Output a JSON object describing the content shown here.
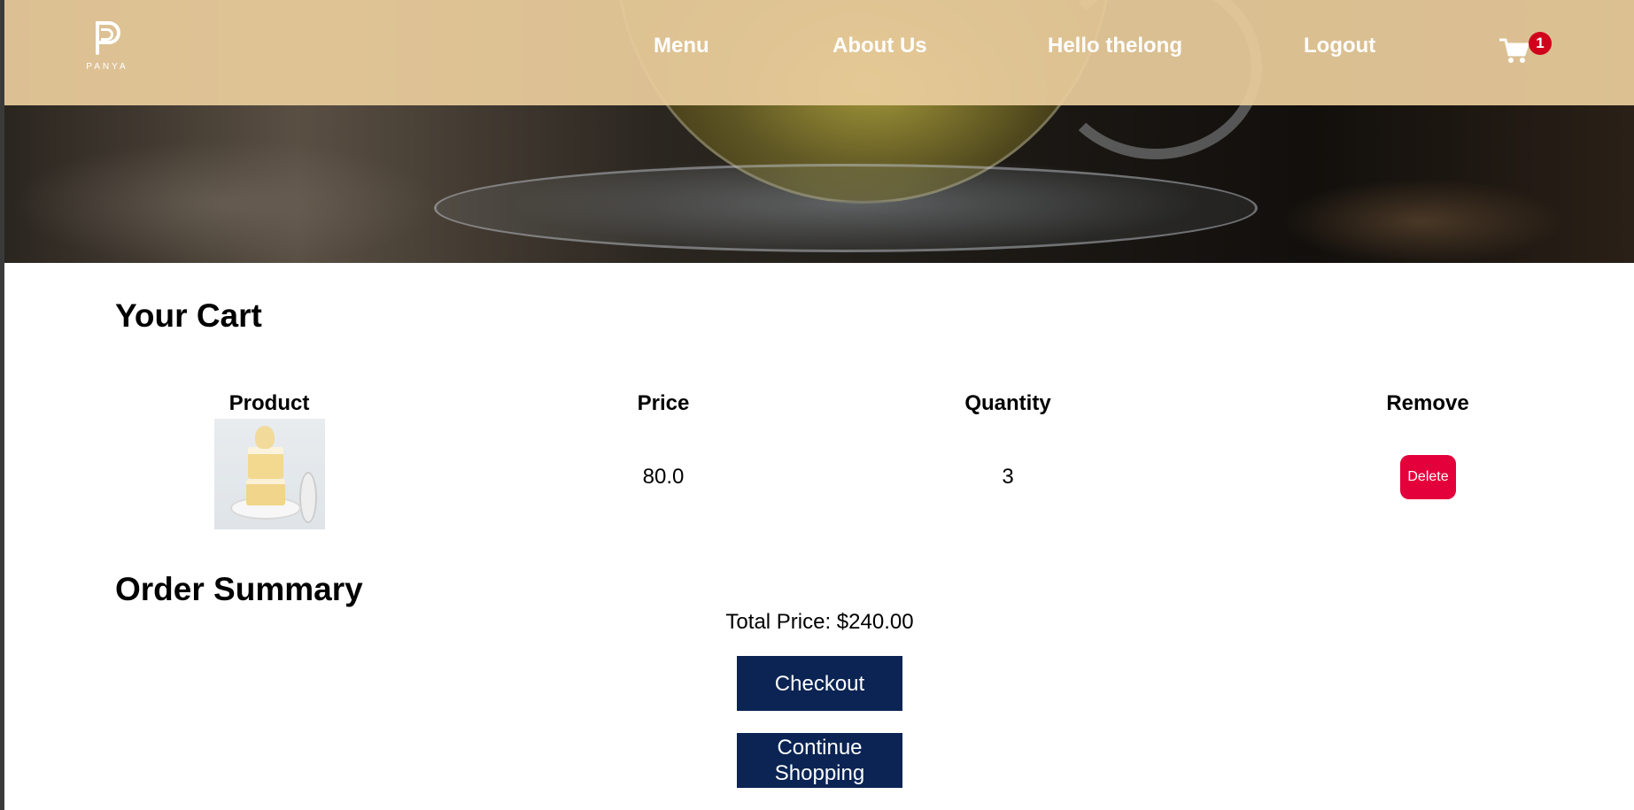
{
  "brand": {
    "logo_text": "PANYA"
  },
  "nav": {
    "menu": "Menu",
    "about": "About Us",
    "greeting": "Hello thelong",
    "logout": "Logout",
    "cart_count": "1"
  },
  "cart": {
    "title": "Your Cart",
    "columns": {
      "product": "Product",
      "price": "Price",
      "quantity": "Quantity",
      "remove": "Remove"
    },
    "items": [
      {
        "image": "vanilla-cake-slice",
        "price": "80.0",
        "quantity": "3",
        "remove_label": "Delete"
      }
    ]
  },
  "summary": {
    "title": "Order Summary",
    "total": "Total Price: $240.00",
    "checkout_label": "Checkout",
    "continue_label": "Continue Shopping"
  },
  "colors": {
    "nav_bg": "#e9cc9c",
    "delete": "#e4003a",
    "button": "#0b2454",
    "badge": "#d0021b"
  }
}
